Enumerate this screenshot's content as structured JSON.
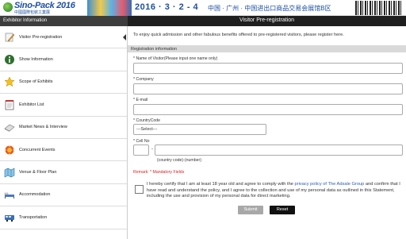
{
  "banner": {
    "logo_text": "Sino-Pack 2016",
    "logo_sub": "中國國際包裝工業展",
    "date": "2016 · 3 · 2 - 4",
    "venue": "中国 · 广州 · 中国进出口商品交易会展馆B区"
  },
  "sidebar": {
    "header": "Exhibitor Information",
    "items": [
      {
        "label": "Visitor Pre-registration",
        "icon": "pencil-icon"
      },
      {
        "label": "Show Information",
        "icon": "info-icon"
      },
      {
        "label": "Scope of Exhibits",
        "icon": "star-icon"
      },
      {
        "label": "Exhibitor List",
        "icon": "notepad-icon"
      },
      {
        "label": "Market News & Interview",
        "icon": "news-icon"
      },
      {
        "label": "Concurrent Events",
        "icon": "event-icon"
      },
      {
        "label": "Venue & Floor Plan",
        "icon": "map-icon"
      },
      {
        "label": "Accommodation",
        "icon": "bed-icon"
      },
      {
        "label": "Transportation",
        "icon": "bus-icon"
      }
    ]
  },
  "main": {
    "title": "Visitor Pre-registration",
    "intro": "To enjoy quick admission and other fabulous benefits offered to pre-registered visitors, please register here.",
    "section_title": "Registration information",
    "fields": {
      "name_label": "* Name of Visitor(Please input one name only)",
      "company_label": "* Company",
      "email_label": "* E-mail",
      "country_label": "* CountryCode",
      "country_value": "---Select---",
      "cell_label": "* Cell No",
      "cell_dash": "-",
      "cell_hint": "(country code)-(number)"
    },
    "remark": "Remark: * Mandatory Fields",
    "certify": {
      "before": "I hereby certify that I am at least 18 year old and agree to comply with the ",
      "link": "privacy policy of The Adsale Group",
      "after": " and confirm that I have read and understand the policy, and I agree to the collection and use of my personal data as outlined in this Statement, including the use and provision of my personal data for direct marketing."
    },
    "submit_label": "Submit",
    "reset_label": "Reset"
  }
}
